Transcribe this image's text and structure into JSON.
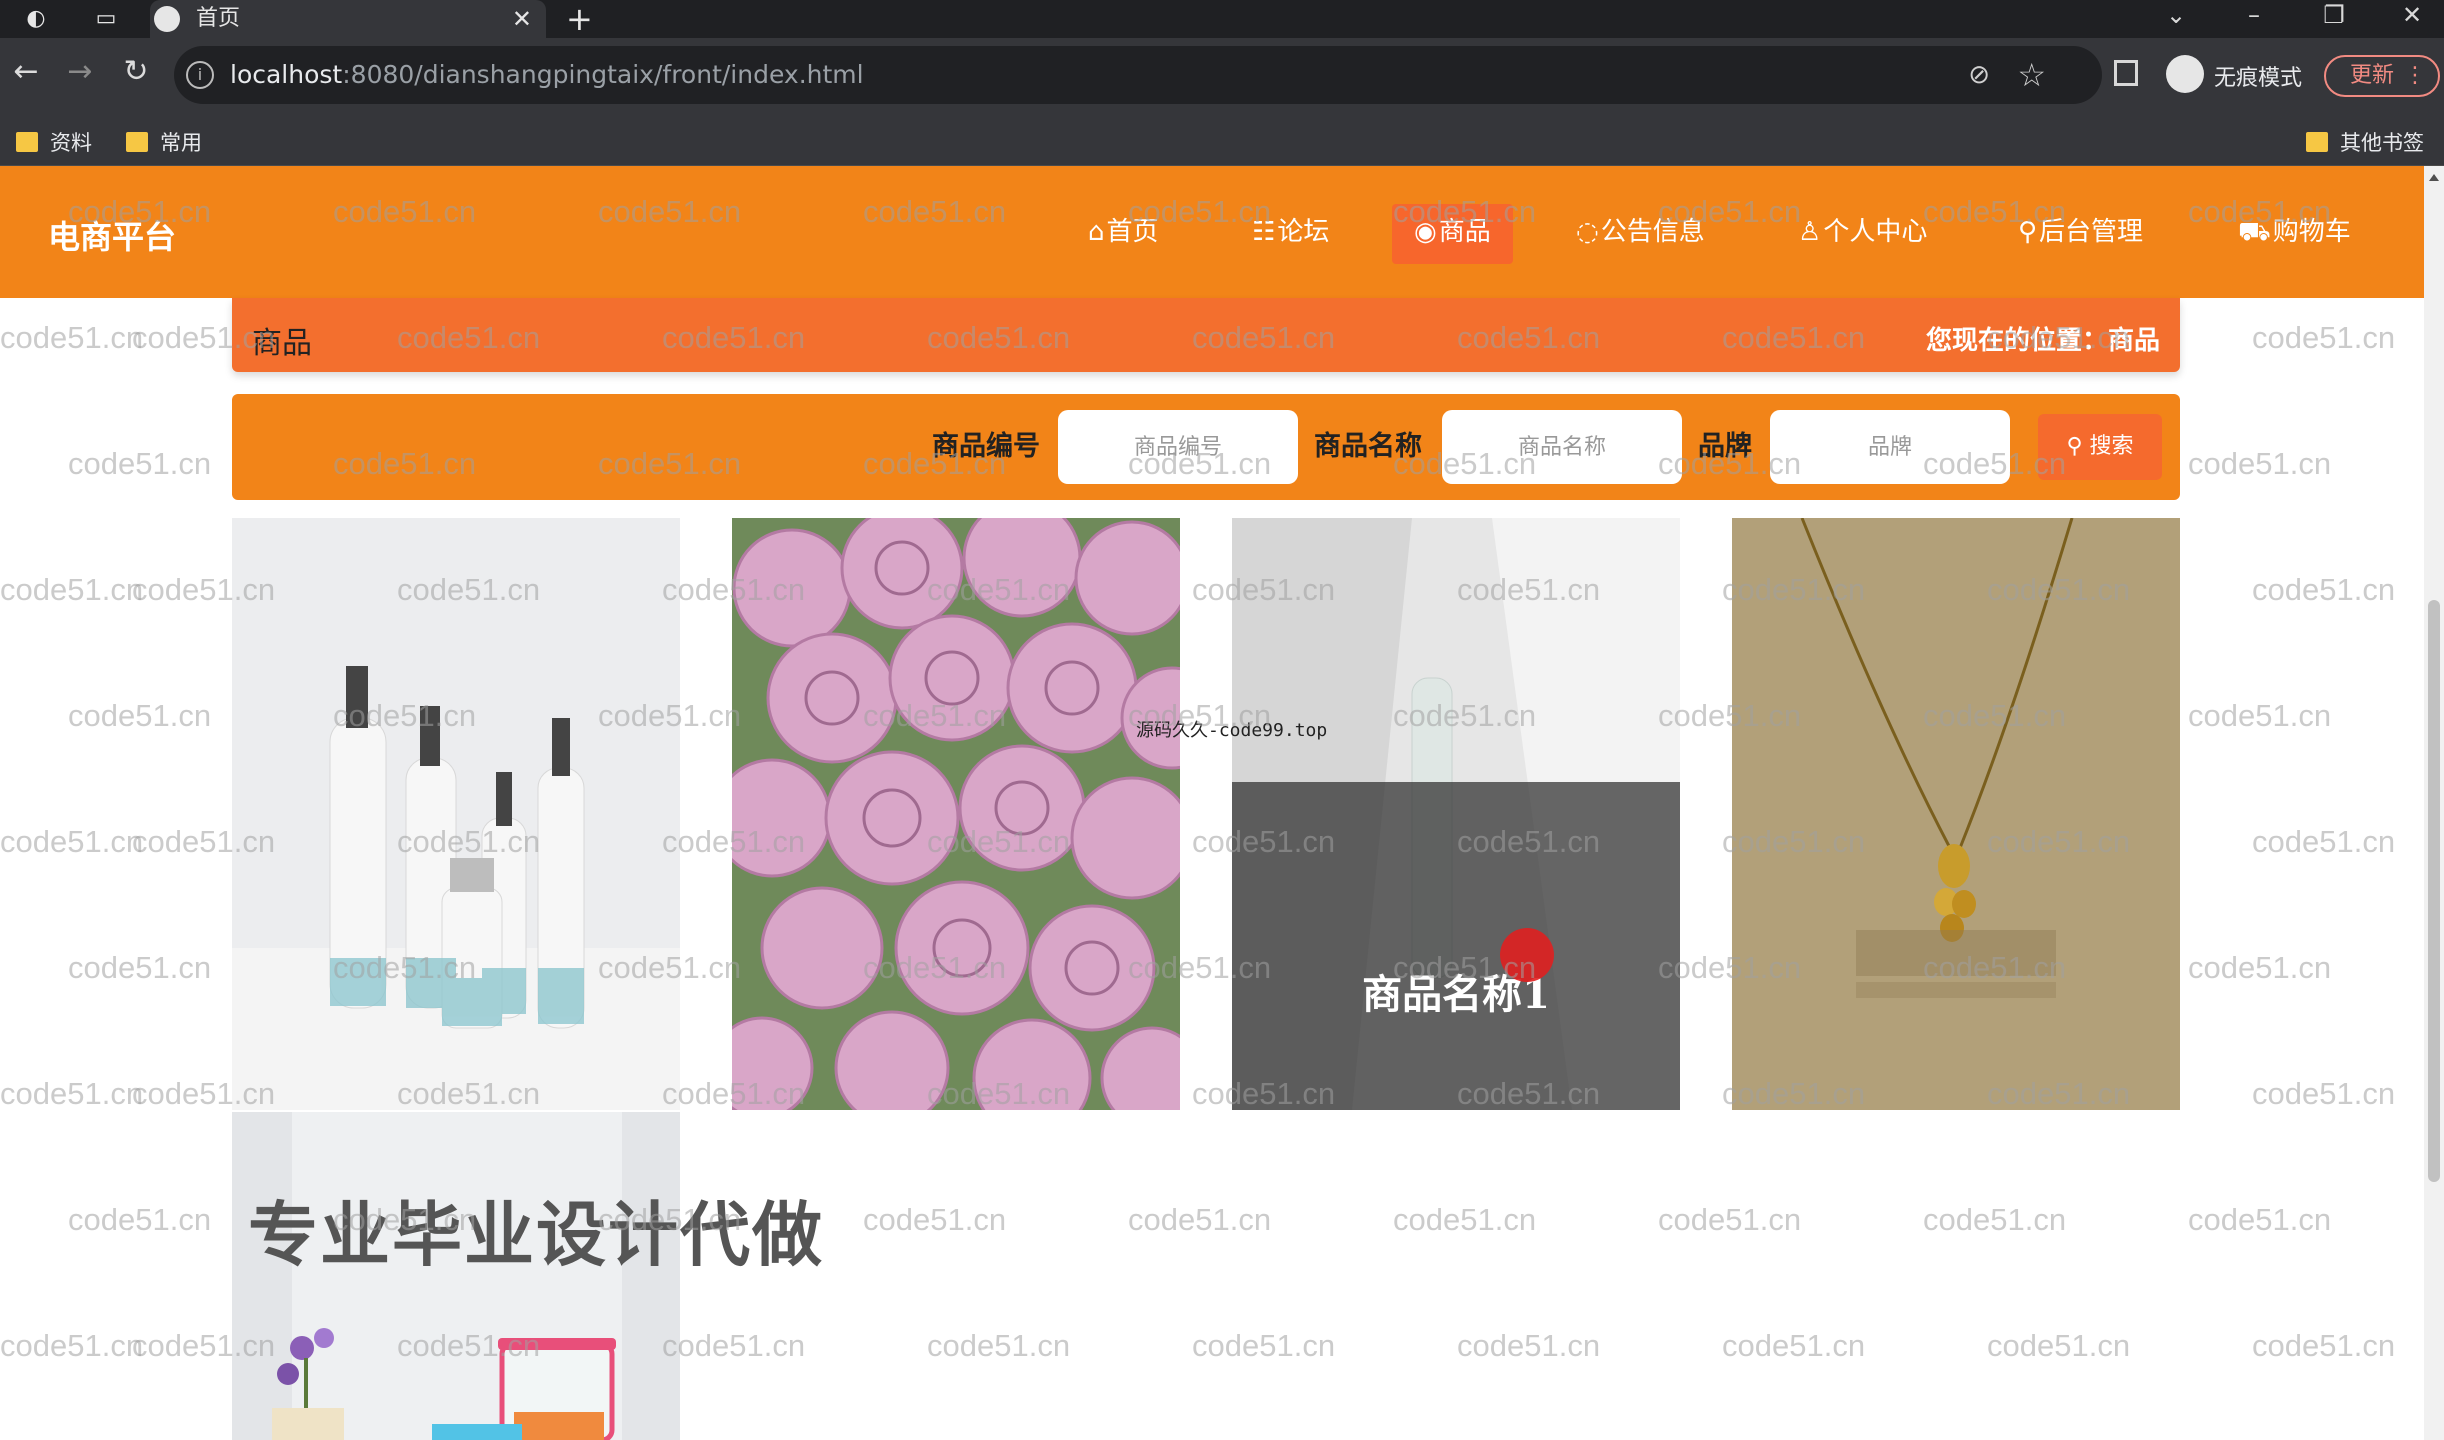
{
  "browser": {
    "tab_title": "首页",
    "url_host": "localhost",
    "url_path": ":8080/dianshangpingtaix/front/index.html",
    "incognito_label": "无痕模式",
    "update_label": "更新",
    "bookmarks": [
      "资料",
      "常用"
    ],
    "other_bookmarks": "其他书签"
  },
  "site": {
    "brand": "电商平台",
    "nav": [
      {
        "icon": "⌂",
        "label": "首页"
      },
      {
        "icon": "☷",
        "label": "论坛"
      },
      {
        "icon": "◉",
        "label": "商品"
      },
      {
        "icon": "◌",
        "label": "公告信息"
      },
      {
        "icon": "♙",
        "label": "个人中心"
      },
      {
        "icon": "⚲",
        "label": "后台管理"
      },
      {
        "icon": "⛟",
        "label": "购物车"
      }
    ],
    "active_nav": "商品"
  },
  "breadcrumb": {
    "title": "商品",
    "position_label": "您现在的位置：",
    "position_value": "商品"
  },
  "search": {
    "code_label": "商品编号",
    "code_placeholder": "商品编号",
    "name_label": "商品名称",
    "name_placeholder": "商品名称",
    "brand_label": "品牌",
    "brand_placeholder": "品牌",
    "button_label": "搜索",
    "button_icon": "search-icon"
  },
  "products": [
    {
      "name": "",
      "image": "cosmetic-bottles"
    },
    {
      "name": "",
      "image": "pink-roses"
    },
    {
      "name": "商品名称1",
      "image": "bottle-hover"
    },
    {
      "name": "",
      "image": "gold-necklace"
    },
    {
      "name": "",
      "image": "food-containers"
    }
  ],
  "overlays": {
    "promo": "专业毕业设计代做",
    "source": "源码久久-code99.top",
    "watermark": "code51.cn"
  },
  "colors": {
    "header": "#f28418",
    "active": "#f7662c",
    "crumb": "#f36f2e"
  }
}
